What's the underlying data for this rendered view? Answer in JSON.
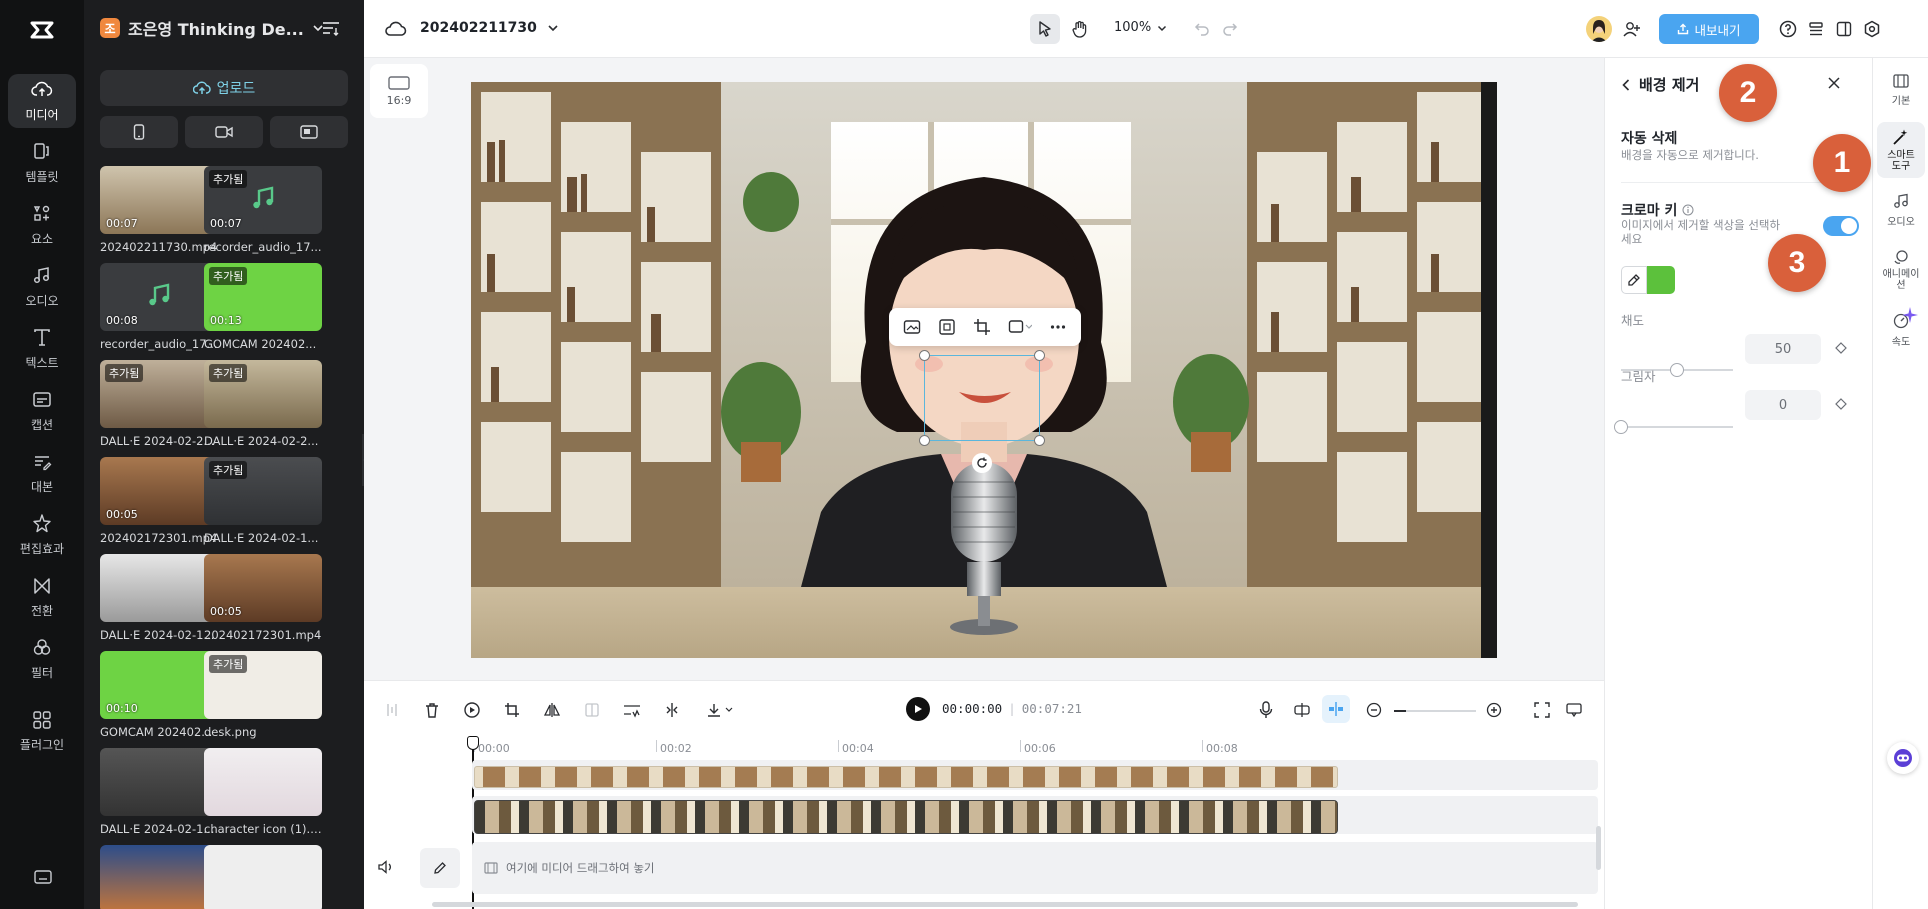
{
  "rail": {
    "items": [
      {
        "label": "미디어",
        "icon": "cloud-upload-icon"
      },
      {
        "label": "템플릿",
        "icon": "template-icon"
      },
      {
        "label": "요소",
        "icon": "elements-icon"
      },
      {
        "label": "오디오",
        "icon": "music-icon"
      },
      {
        "label": "텍스트",
        "icon": "text-icon"
      },
      {
        "label": "캡션",
        "icon": "caption-icon"
      },
      {
        "label": "대본",
        "icon": "script-icon"
      },
      {
        "label": "편집효과",
        "icon": "effects-icon"
      },
      {
        "label": "전환",
        "icon": "transition-icon"
      },
      {
        "label": "필터",
        "icon": "filter-icon"
      },
      {
        "label": "플러그인",
        "icon": "plugin-icon"
      }
    ]
  },
  "media": {
    "project_badge": "조",
    "project_name": "조은영 Thinking De...",
    "upload_label": "업로드",
    "items": [
      {
        "name": "202402211730.mp4",
        "duration": "00:07",
        "tag": ""
      },
      {
        "name": "recorder_audio_17...",
        "duration": "00:07",
        "tag": "추가됨"
      },
      {
        "name": "recorder_audio_17...",
        "duration": "00:08",
        "tag": ""
      },
      {
        "name": "GOMCAM 202402...",
        "duration": "00:13",
        "tag": "추가됨"
      },
      {
        "name": "DALL·E 2024-02-2...",
        "duration": "",
        "tag": "추가됨"
      },
      {
        "name": "DALL·E 2024-02-2...",
        "duration": "",
        "tag": "추가됨"
      },
      {
        "name": "202402172301.mp4",
        "duration": "00:05",
        "tag": ""
      },
      {
        "name": "DALL·E 2024-02-1...",
        "duration": "",
        "tag": "추가됨"
      },
      {
        "name": "DALL·E 2024-02-1...",
        "duration": "",
        "tag": ""
      },
      {
        "name": "202402172301.mp4",
        "duration": "00:05",
        "tag": ""
      },
      {
        "name": "GOMCAM 202402...",
        "duration": "00:10",
        "tag": ""
      },
      {
        "name": "desk.png",
        "duration": "",
        "tag": "추가됨"
      },
      {
        "name": "DALL·E 2024-02-1...",
        "duration": "",
        "tag": ""
      },
      {
        "name": "character icon (1).p...",
        "duration": "",
        "tag": ""
      },
      {
        "name": "",
        "duration": "",
        "tag": ""
      },
      {
        "name": "",
        "duration": "",
        "tag": ""
      }
    ]
  },
  "topbar": {
    "project_title": "202402211730",
    "zoom": "100%",
    "export_label": "내보내기"
  },
  "canvas": {
    "ratio_label": "16:9"
  },
  "right_panel": {
    "title": "배경 제거",
    "auto_remove_title": "자동 삭제",
    "auto_remove_desc": "배경을 자동으로 제거합니다.",
    "chroma_title": "크로마 키",
    "chroma_desc": "이미지에서 제거할 색상을 선택하세요",
    "chroma_enabled": true,
    "key_color": "#5cc13c",
    "saturation_label": "채도",
    "saturation_value": "50",
    "saturation_level": 50,
    "shadow_label": "그림자",
    "shadow_value": "0",
    "shadow_level": 0
  },
  "right_tabs": [
    {
      "label": "기본",
      "icon": "basic-icon"
    },
    {
      "label": "스마트 도구",
      "icon": "magic-wand-icon"
    },
    {
      "label": "오디오",
      "icon": "audio-icon"
    },
    {
      "label": "애니메이션",
      "icon": "animation-icon"
    },
    {
      "label": "속도",
      "icon": "speed-icon"
    }
  ],
  "annotations": [
    "1",
    "2",
    "3"
  ],
  "timeline": {
    "current_time": "00:00:00",
    "total_time": "00:07:21",
    "ruler": [
      "00:00",
      "00:02",
      "00:04",
      "00:06",
      "00:08"
    ],
    "drop_hint": "여기에 미디어 드래그하여 놓기"
  },
  "colors": {
    "accent": "#4aa5f0",
    "annotation": "#d9603b",
    "rail_bg": "#111213",
    "media_bg": "#1c1d1f"
  }
}
